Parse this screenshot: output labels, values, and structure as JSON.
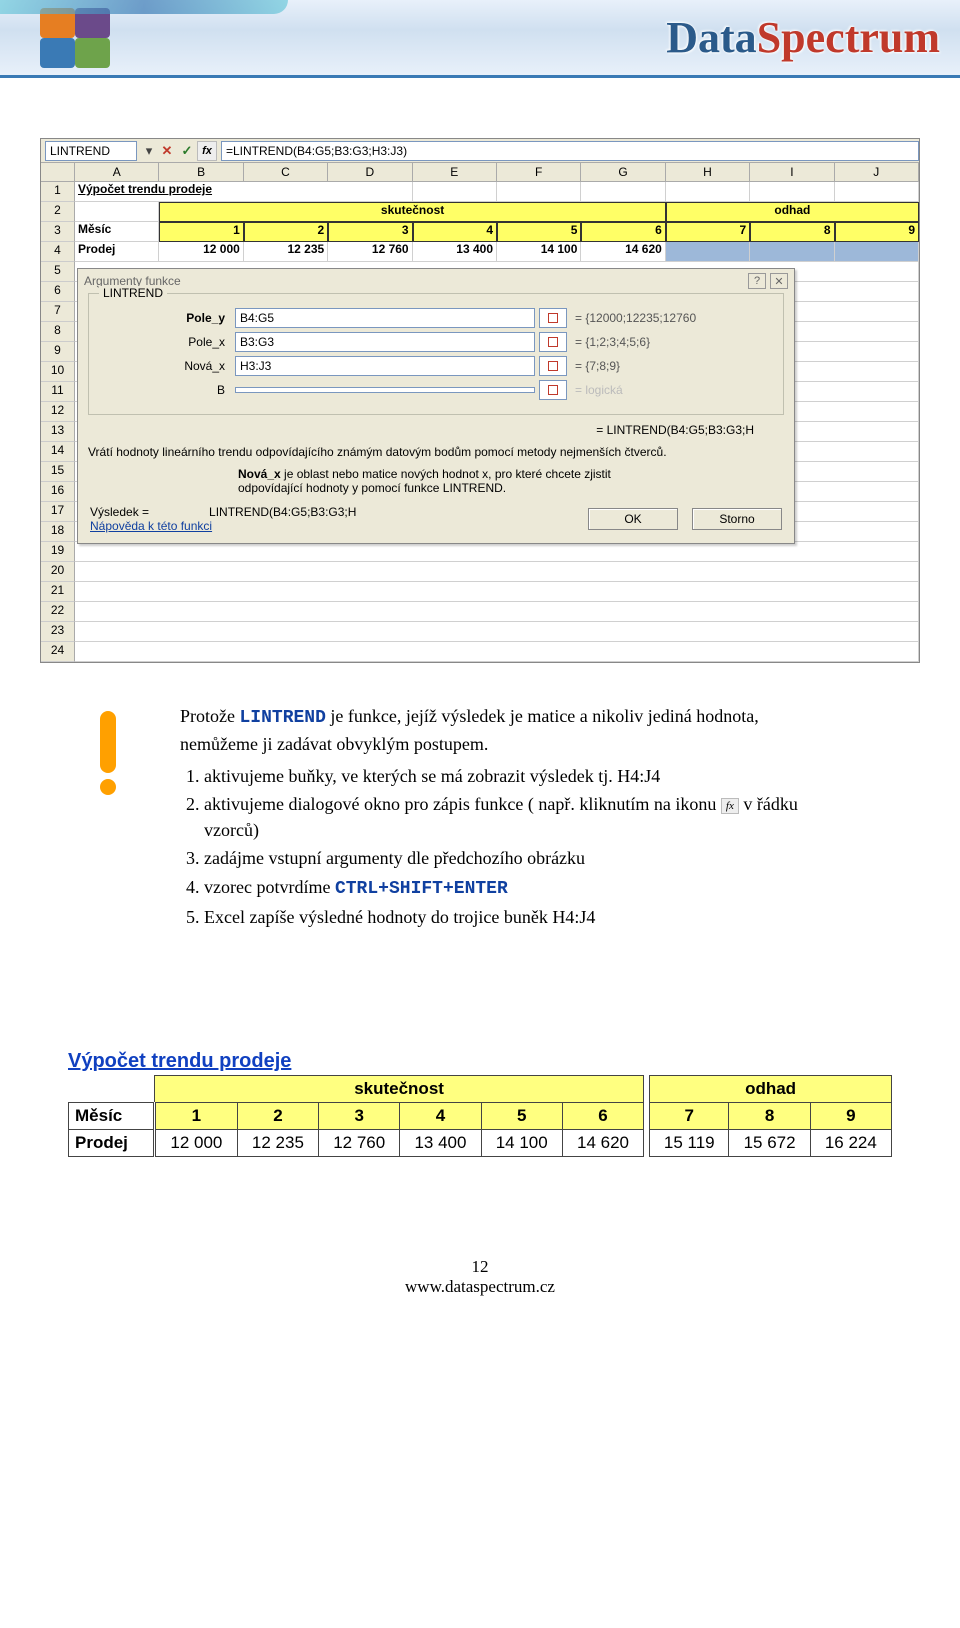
{
  "header": {
    "brand_prefix": "Data",
    "brand_suffix": "Spectrum"
  },
  "excel": {
    "namebox": "LINTREND",
    "formula": "=LINTREND(B4:G5;B3:G3;H3:J3)",
    "col_headers": [
      "A",
      "B",
      "C",
      "D",
      "E",
      "F",
      "G",
      "H",
      "I",
      "J"
    ],
    "row1_title": "Výpočet trendu prodeje",
    "row2": {
      "group1": "skutečnost",
      "group2": "odhad"
    },
    "row3_label": "Měsíc",
    "row3_vals": [
      "1",
      "2",
      "3",
      "4",
      "5",
      "6",
      "7",
      "8",
      "9"
    ],
    "row4_label": "Prodej",
    "row4_vals": [
      "12 000",
      "12 235",
      "12 760",
      "13 400",
      "14 100",
      "14 620",
      "",
      "",
      ""
    ],
    "row_nums": [
      "1",
      "2",
      "3",
      "4",
      "5",
      "6",
      "7",
      "8",
      "9",
      "10",
      "11",
      "12",
      "13",
      "14",
      "15",
      "16",
      "17",
      "18",
      "19",
      "20",
      "21",
      "22",
      "23",
      "24"
    ]
  },
  "dialog": {
    "title": "Argumenty funkce",
    "legend": "LINTREND",
    "args": [
      {
        "label": "Pole_y",
        "bold": true,
        "value": "B4:G5",
        "result": "= {12000;12235;12760"
      },
      {
        "label": "Pole_x",
        "bold": false,
        "value": "B3:G3",
        "result": "= {1;2;3;4;5;6}"
      },
      {
        "label": "Nová_x",
        "bold": false,
        "value": "H3:J3",
        "result": "= {7;8;9}"
      },
      {
        "label": "B",
        "bold": false,
        "value": "",
        "result": "= logická"
      }
    ],
    "result_eq": "= LINTREND(B4:G5;B3:G3;H",
    "desc": "Vrátí hodnoty lineárního trendu odpovídajícího známým datovým bodům pomocí metody nejmenších čtverců.",
    "arg_help_label": "Nová_x",
    "arg_help_text": " je oblast nebo matice nových hodnot x, pro které chcete zjistit odpovídající hodnoty y pomocí funkce LINTREND.",
    "bottom_result_label": "Výsledek =",
    "bottom_result_value": "LINTREND(B4:G5;B3:G3;H",
    "help_link": "Nápověda k této funkci",
    "btn_ok": "OK",
    "btn_cancel": "Storno"
  },
  "doc": {
    "intro_a": "Protože ",
    "intro_fn": "LINTREND",
    "intro_b": " je funkce, jejíž výsledek je matice a nikoliv jediná hodnota, nemůžeme ji zadávat obvyklým postupem.",
    "steps": [
      "aktivujeme buňky, ve kterých se má zobrazit výsledek tj. H4:J4",
      "aktivujeme dialogové okno pro zápis funkce ( např. kliknutím na ikonu  v řádku vzorců)",
      "zadájme vstupní argumenty dle předchozího obrázku",
      "vzorec potvrdíme CTRL+SHIFT+ENTER",
      "Excel zapíše výsledné hodnoty do trojice buněk H4:J4"
    ],
    "step4_prefix": "vzorec potvrdíme ",
    "step4_code": "CTRL+SHIFT+ENTER",
    "step2_prefix": "aktivujeme dialogové okno pro zápis funkce ( např. kliknutím na ikonu ",
    "step2_suffix": " v řádku vzorců)"
  },
  "result": {
    "title": "Výpočet trendu prodeje",
    "group1": "skutečnost",
    "group2": "odhad",
    "months_label": "Měsíc",
    "sales_label": "Prodej",
    "months": [
      "1",
      "2",
      "3",
      "4",
      "5",
      "6",
      "7",
      "8",
      "9"
    ],
    "sales": [
      "12 000",
      "12 235",
      "12 760",
      "13 400",
      "14 100",
      "14 620",
      "15 119",
      "15 672",
      "16 224"
    ]
  },
  "chart_data": {
    "type": "table",
    "title": "Výpočet trendu prodeje",
    "series": [
      {
        "name": "skutečnost",
        "x": [
          1,
          2,
          3,
          4,
          5,
          6
        ],
        "y": [
          12000,
          12235,
          12760,
          13400,
          14100,
          14620
        ]
      },
      {
        "name": "odhad",
        "x": [
          7,
          8,
          9
        ],
        "y": [
          15119,
          15672,
          16224
        ]
      }
    ],
    "xlabel": "Měsíc",
    "ylabel": "Prodej"
  },
  "footer": {
    "page": "12",
    "url": "www.dataspectrum.cz"
  }
}
